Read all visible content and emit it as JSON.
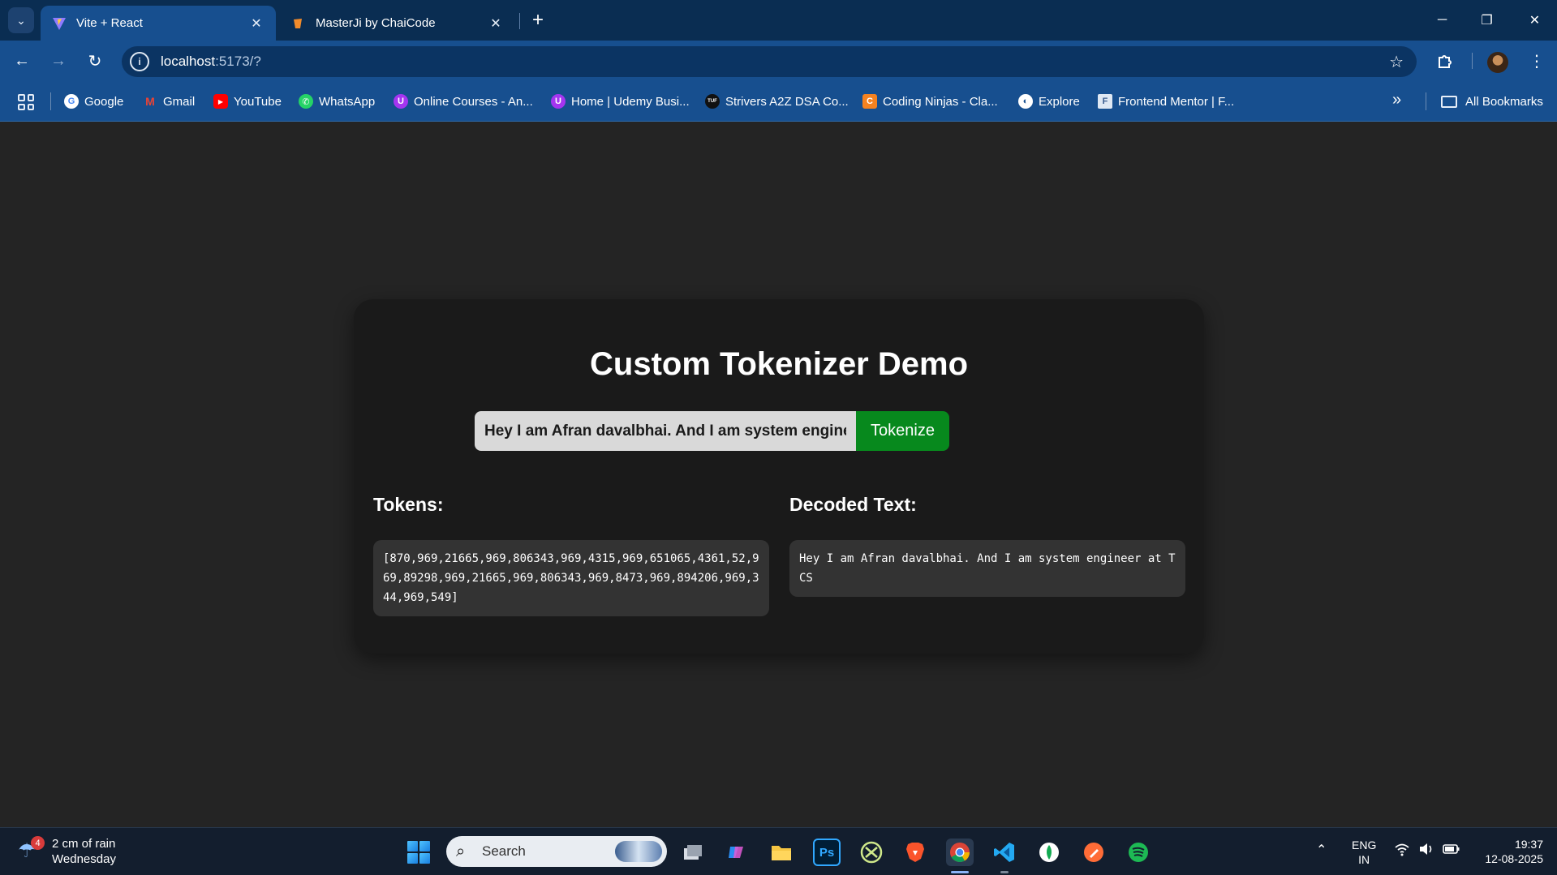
{
  "browser": {
    "tabs": [
      {
        "title": "Vite + React",
        "active": true
      },
      {
        "title": "MasterJi by ChaiCode",
        "active": false
      }
    ],
    "url_host": "localhost",
    "url_path": ":5173/?",
    "bookmarks": [
      {
        "label": "Google",
        "icon": "G",
        "color": "#ffffff"
      },
      {
        "label": "Gmail",
        "icon": "M",
        "color": "#ea4335"
      },
      {
        "label": "YouTube",
        "icon": "▶",
        "color": "#ff0000"
      },
      {
        "label": "WhatsApp",
        "icon": "✆",
        "color": "#25d366"
      },
      {
        "label": "Online Courses - An...",
        "icon": "U",
        "color": "#a435f0"
      },
      {
        "label": "Home | Udemy Busi...",
        "icon": "U",
        "color": "#a435f0"
      },
      {
        "label": "Strivers A2Z DSA Co...",
        "icon": "TUF",
        "color": "#111111"
      },
      {
        "label": "Coding Ninjas - Cla...",
        "icon": "C",
        "color": "#f58220"
      },
      {
        "label": "Explore",
        "icon": "◐",
        "color": "#ffffff"
      },
      {
        "label": "Frontend Mentor | F...",
        "icon": "F",
        "color": "#dfe8f3"
      }
    ],
    "all_bookmarks": "All Bookmarks"
  },
  "page": {
    "title": "Custom Tokenizer Demo",
    "input_value": "Hey I am Afran davalbhai. And I am system engineer at TCS",
    "button_label": "Tokenize",
    "tokens_title": "Tokens:",
    "tokens_output": "[870,969,21665,969,806343,969,4315,969,651065,4361,52,969,89298,969,21665,969,806343,969,8473,969,894206,969,344,969,549]",
    "decoded_title": "Decoded Text:",
    "decoded_output": "Hey I am Afran davalbhai. And I am system engineer at TCS",
    "accent_green": "#07891d"
  },
  "taskbar": {
    "weather_line1": "2 cm of rain",
    "weather_line2": "Wednesday",
    "weather_badge": "4",
    "search_placeholder": "Search",
    "lang_line1": "ENG",
    "lang_line2": "IN",
    "time": "19:37",
    "date": "12-08-2025"
  }
}
